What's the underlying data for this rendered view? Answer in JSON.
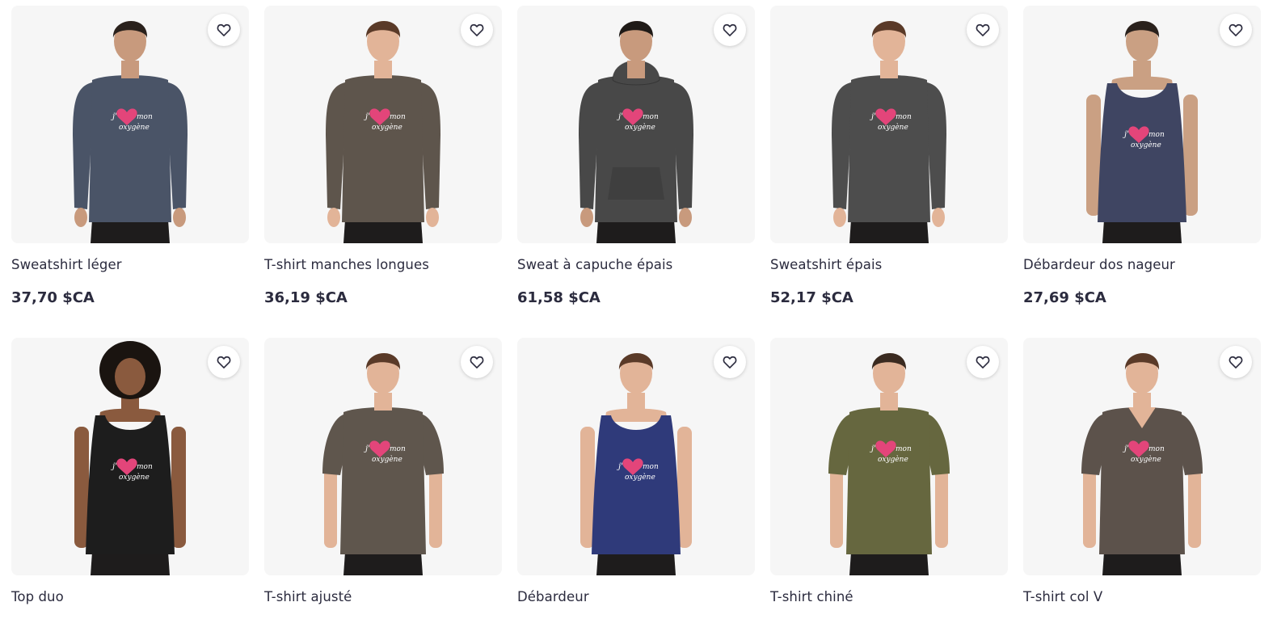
{
  "products": [
    {
      "title": "Sweatshirt léger",
      "price": "37,70 $CA",
      "garment": "sweatshirt",
      "color": "#4a5467",
      "skin": "#c89a7d",
      "hair": "#2a211c",
      "design": [
        "j'",
        "mon",
        "oxygène"
      ]
    },
    {
      "title": "T-shirt manches longues",
      "price": "36,19 $CA",
      "garment": "longsleeve",
      "color": "#5e554c",
      "skin": "#e2b498",
      "hair": "#5a3a28",
      "design": [
        "j'",
        "mon",
        "oxygène"
      ]
    },
    {
      "title": "Sweat à capuche épais",
      "price": "61,58 $CA",
      "garment": "hoodie",
      "color": "#484848",
      "skin": "#c89a7d",
      "hair": "#1f1a17",
      "design": [
        "j'",
        "mon",
        "oxygène"
      ]
    },
    {
      "title": "Sweatshirt épais",
      "price": "52,17 $CA",
      "garment": "sweatshirt",
      "color": "#4d4d4d",
      "skin": "#e2b498",
      "hair": "#5a3a28",
      "design": [
        "j'",
        "mon",
        "oxygène"
      ]
    },
    {
      "title": "Débardeur dos nageur",
      "price": "27,69 $CA",
      "garment": "racerback",
      "color": "#3f4562",
      "skin": "#caa083",
      "hair": "#2a211c",
      "design": [
        "j'",
        "mon",
        "oxygène"
      ]
    },
    {
      "title": "Top duo",
      "price": "",
      "garment": "tank-f",
      "color": "#1d1d1d",
      "skin": "#8a5a3e",
      "hair": "#1a1410",
      "design": [
        "j'",
        "mon",
        "oxygène"
      ]
    },
    {
      "title": "T-shirt ajusté",
      "price": "",
      "garment": "tee",
      "color": "#5f564d",
      "skin": "#e2b498",
      "hair": "#5a3a28",
      "design": [
        "j'",
        "mon",
        "oxygène"
      ]
    },
    {
      "title": "Débardeur",
      "price": "",
      "garment": "tank",
      "color": "#2f3a7a",
      "skin": "#e2b498",
      "hair": "#5a3a28",
      "design": [
        "j'",
        "mon",
        "oxygène"
      ]
    },
    {
      "title": "T-shirt chiné",
      "price": "",
      "garment": "tee",
      "color": "#66673f",
      "skin": "#e2b498",
      "hair": "#3a2a20",
      "design": [
        "j'",
        "mon",
        "oxygène"
      ]
    },
    {
      "title": "T-shirt col V",
      "price": "",
      "garment": "vneck",
      "color": "#5c524b",
      "skin": "#e2b498",
      "hair": "#5a3a28",
      "design": [
        "j'",
        "mon",
        "oxygène"
      ]
    }
  ],
  "icons": {
    "favorite": "heart-outline-icon"
  },
  "colors": {
    "tile_background": "#f6f6f6",
    "text": "#2b2b3e",
    "heart_accent": "#e3457a"
  }
}
